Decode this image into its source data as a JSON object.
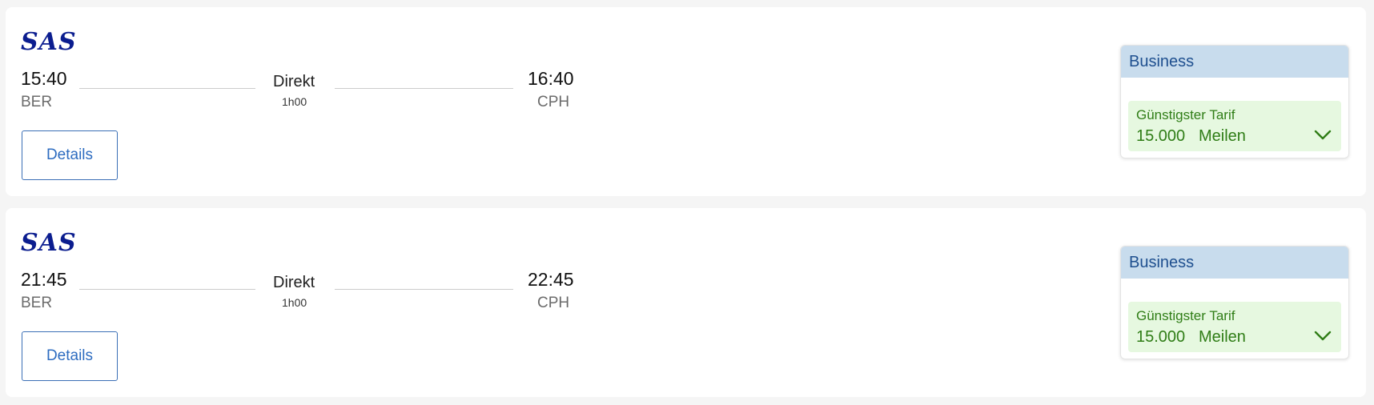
{
  "flights": [
    {
      "airline": "SAS",
      "departure": {
        "time": "15:40",
        "code": "BER"
      },
      "arrival": {
        "time": "16:40",
        "code": "CPH"
      },
      "stops": "Direkt",
      "duration": "1h00",
      "details_label": "Details",
      "fare": {
        "cabin": "Business",
        "label": "Günstigster Tarif",
        "amount": "15.000",
        "unit": "Meilen",
        "icon": "chevron-down-icon"
      }
    },
    {
      "airline": "SAS",
      "departure": {
        "time": "21:45",
        "code": "BER"
      },
      "arrival": {
        "time": "22:45",
        "code": "CPH"
      },
      "stops": "Direkt",
      "duration": "1h00",
      "details_label": "Details",
      "fare": {
        "cabin": "Business",
        "label": "Günstigster Tarif",
        "amount": "15.000",
        "unit": "Meilen",
        "icon": "chevron-down-icon"
      }
    }
  ],
  "colors": {
    "brand": "#0b1d8f",
    "cabin_header_bg": "#c8dced",
    "fare_bg": "#e6f8e0",
    "fare_text": "#2f7d16",
    "link": "#2d6cc0"
  }
}
